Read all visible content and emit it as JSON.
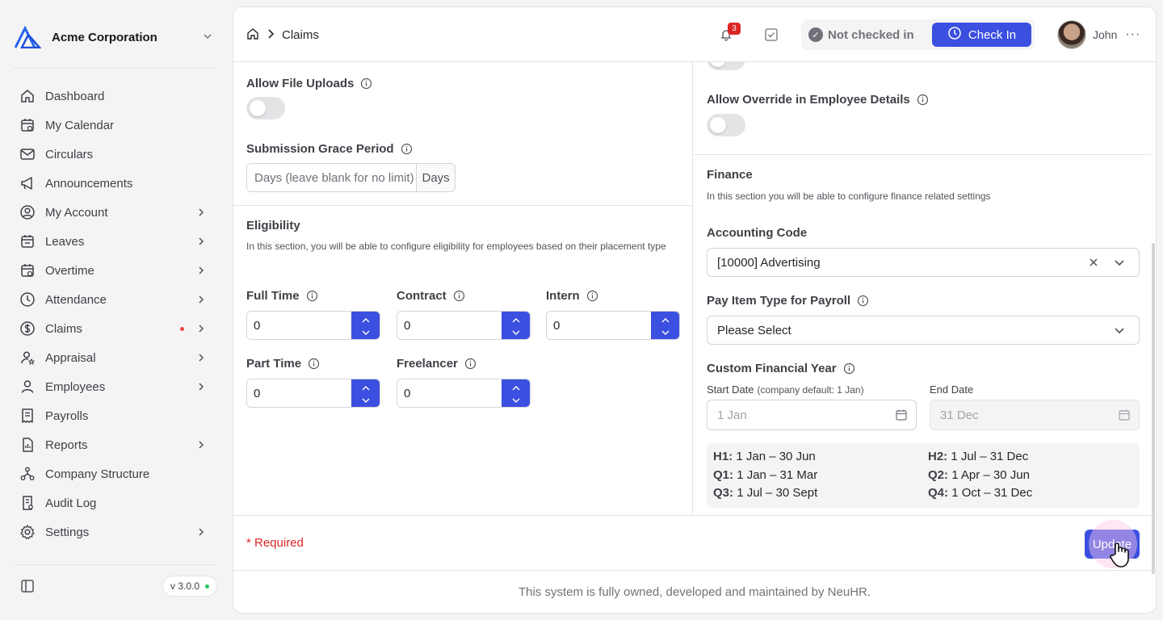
{
  "brand": {
    "name": "Acme Corporation"
  },
  "nav": [
    {
      "label": "Dashboard",
      "icon": "home-icon",
      "arrow": false
    },
    {
      "label": "My Calendar",
      "icon": "calendar-icon",
      "arrow": false
    },
    {
      "label": "Circulars",
      "icon": "mail-icon",
      "arrow": false
    },
    {
      "label": "Announcements",
      "icon": "megaphone-icon",
      "arrow": false
    },
    {
      "label": "My Account",
      "icon": "user-circle-icon",
      "arrow": true
    },
    {
      "label": "Leaves",
      "icon": "calendar-leave-icon",
      "arrow": true
    },
    {
      "label": "Overtime",
      "icon": "calendar-clock-icon",
      "arrow": true
    },
    {
      "label": "Attendance",
      "icon": "clock-icon",
      "arrow": true
    },
    {
      "label": "Claims",
      "icon": "dollar-circle-icon",
      "arrow": true,
      "dot": true
    },
    {
      "label": "Appraisal",
      "icon": "user-star-icon",
      "arrow": true
    },
    {
      "label": "Employees",
      "icon": "user-icon",
      "arrow": true
    },
    {
      "label": "Payrolls",
      "icon": "receipt-icon",
      "arrow": false
    },
    {
      "label": "Reports",
      "icon": "report-icon",
      "arrow": true
    },
    {
      "label": "Company Structure",
      "icon": "org-structure-icon",
      "arrow": false
    },
    {
      "label": "Audit Log",
      "icon": "audit-log-icon",
      "arrow": false
    },
    {
      "label": "Settings",
      "icon": "gear-icon",
      "arrow": true
    }
  ],
  "version": "v 3.0.0",
  "header": {
    "breadcrumb_current": "Claims",
    "notifications_count": "3",
    "status": "Not checked in",
    "checkin_label": "Check In",
    "user_name": "John"
  },
  "left": {
    "file_uploads_label": "Allow File Uploads",
    "grace_label": "Submission Grace Period",
    "grace_placeholder": "Days (leave blank for no limit)",
    "grace_suffix": "Days",
    "eligibility_title": "Eligibility",
    "eligibility_desc": "In this section, you will be able to configure eligibility for employees based on their placement type",
    "fields": [
      {
        "label": "Full Time",
        "value": "0"
      },
      {
        "label": "Contract",
        "value": "0"
      },
      {
        "label": "Intern",
        "value": "0"
      },
      {
        "label": "Part Time",
        "value": "0"
      },
      {
        "label": "Freelancer",
        "value": "0"
      }
    ]
  },
  "right": {
    "override_label": "Allow Override in Employee Details",
    "finance_title": "Finance",
    "finance_desc": "In this section you will be able to configure finance related settings",
    "accounting_label": "Accounting Code",
    "accounting_value": "[10000] Advertising",
    "payitem_label": "Pay Item Type for Payroll",
    "payitem_value": "Please Select",
    "fy_label": "Custom Financial Year",
    "start_label": "Start Date",
    "start_hint": "(company default: 1 Jan)",
    "start_placeholder": "1 Jan",
    "end_label": "End Date",
    "end_placeholder": "31 Dec",
    "periods": {
      "h1_k": "H1:",
      "h1_v": "1 Jan – 30 Jun",
      "h2_k": "H2:",
      "h2_v": "1 Jul – 31 Dec",
      "q1_k": "Q1:",
      "q1_v": "1 Jan – 31 Mar",
      "q2_k": "Q2:",
      "q2_v": "1 Apr – 30 Jun",
      "q3_k": "Q3:",
      "q3_v": "1 Jul – 30 Sept",
      "q4_k": "Q4:",
      "q4_v": "1 Oct – 31 Dec"
    }
  },
  "footer": {
    "required": "* Required",
    "update_label": "Update",
    "ownership": "This system is fully owned, developed and maintained by NeuHR."
  },
  "colors": {
    "accent": "#3b4fe0",
    "danger": "#dc2626",
    "online": "#22c55e"
  }
}
